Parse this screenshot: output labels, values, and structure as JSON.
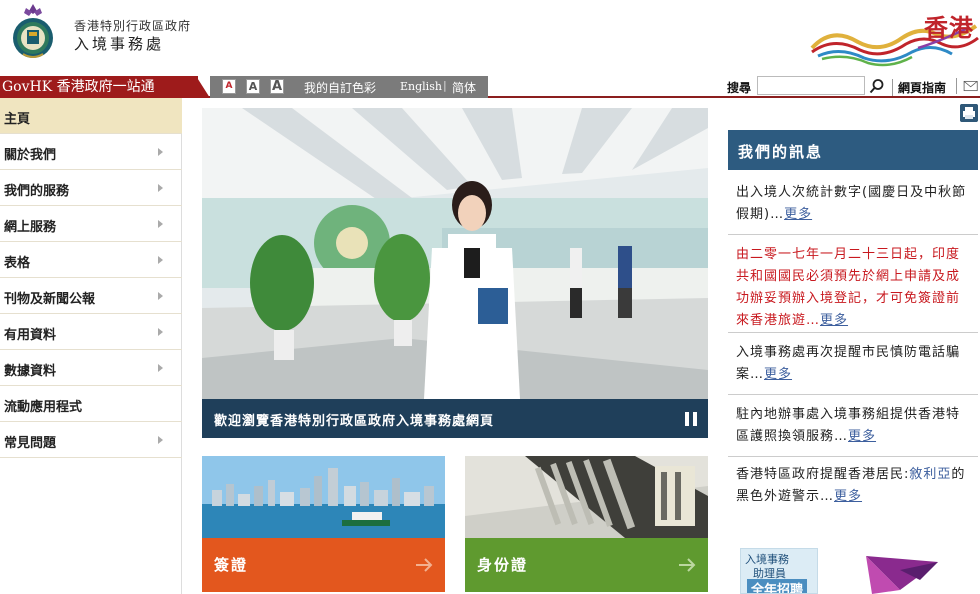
{
  "header": {
    "dept_line1": "香港特別行政區政府",
    "dept_line2": "入境事務處",
    "brand_text": "香港"
  },
  "topbar": {
    "govhk": "GovHK 香港政府一站通",
    "font_small": "A",
    "font_medium": "A",
    "font_large": "A",
    "colour": "我的自訂色彩",
    "lang_en": "English",
    "lang_sep": "|",
    "lang_sc": "简体",
    "search_label": "搜尋",
    "search_value": "",
    "sitemap": "網頁指南"
  },
  "sidebar": {
    "items": [
      {
        "label": "主頁",
        "arrow": false
      },
      {
        "label": "關於我們",
        "arrow": true
      },
      {
        "label": "我們的服務",
        "arrow": true
      },
      {
        "label": "網上服務",
        "arrow": true
      },
      {
        "label": "表格",
        "arrow": true
      },
      {
        "label": "刊物及新聞公報",
        "arrow": true
      },
      {
        "label": "有用資料",
        "arrow": true
      },
      {
        "label": "數據資料",
        "arrow": true
      },
      {
        "label": "流動應用程式",
        "arrow": false
      },
      {
        "label": "常見問題",
        "arrow": true
      }
    ]
  },
  "banner": {
    "caption": "歡迎瀏覽香港特別行政區政府入境事務處網頁"
  },
  "tiles": {
    "visa": "簽證",
    "id": "身份證"
  },
  "messages": {
    "title": "我們的訊息",
    "more": "更多",
    "items": [
      {
        "text": "出入境人次統計數字(國慶日及中秋節假期)…",
        "more": "更多"
      },
      {
        "text": "由二零一七年一月二十三日起，印度共和國國民必須預先於網上申請及成功辦妥預辦入境登記，才可免簽證前來香港旅遊…",
        "more": "更多"
      },
      {
        "text": "入境事務處再次提醒市民慎防電話騙案…",
        "more": "更多"
      },
      {
        "text": "駐內地辦事處入境事務組提供香港特區護照換領服務…",
        "more": "更多"
      },
      {
        "text_a": "香港特區政府提醒香港居民:",
        "text_hl": "敘利亞",
        "text_b": "的黑色外遊警示…",
        "more": "更多"
      }
    ]
  },
  "promos": {
    "recruit_line1": "入境事務",
    "recruit_line2": "助理員",
    "recruit_line3": "全年招聘"
  },
  "colors": {
    "govhk_red": "#9e1b1b",
    "panel_blue": "#2d5b80",
    "visa_orange": "#e3571e",
    "id_green": "#5f9a2f",
    "alert_red": "#c8191f",
    "link_blue": "#3d5f9e"
  }
}
